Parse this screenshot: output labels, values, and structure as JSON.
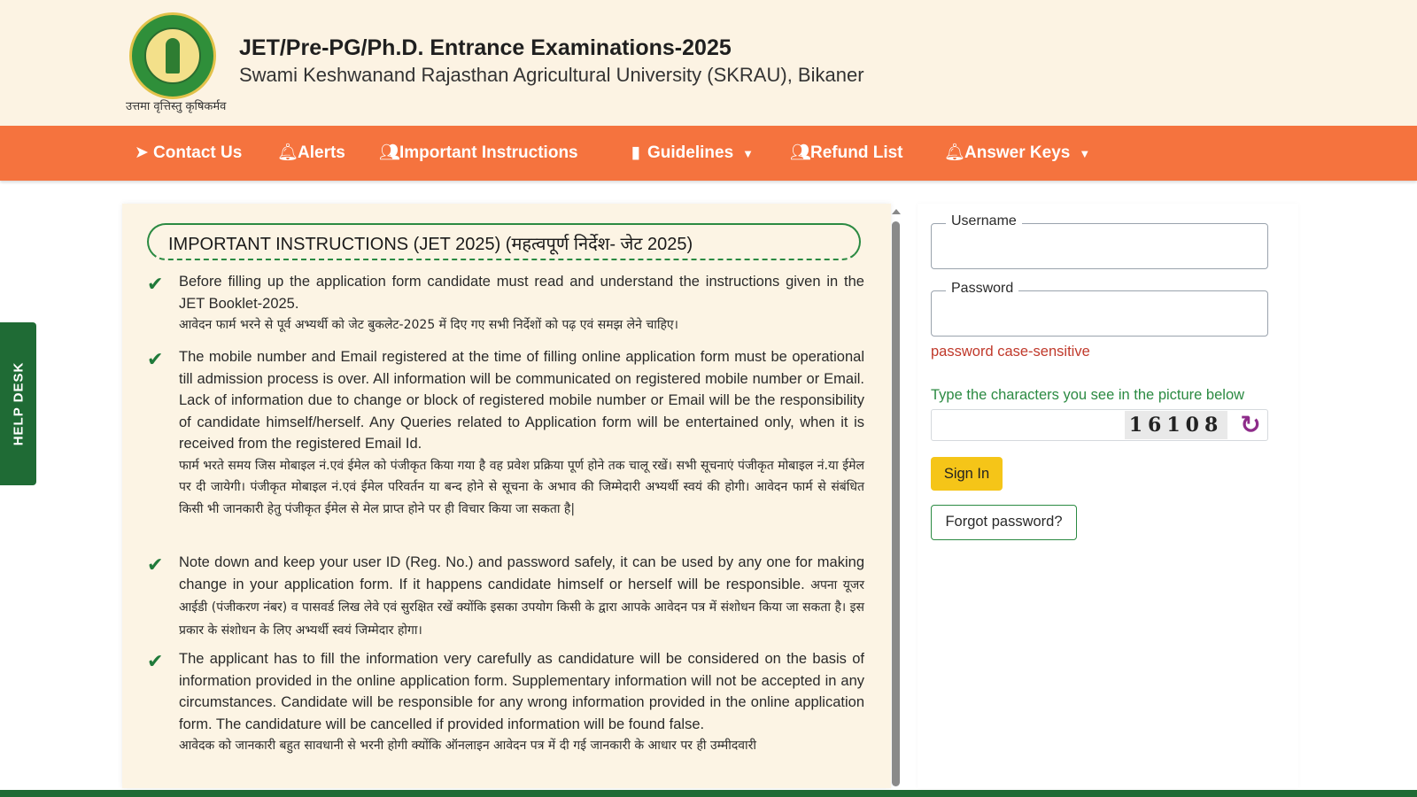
{
  "header": {
    "title": "JET/Pre-PG/Ph.D. Entrance Examinations-2025",
    "subtitle": "Swami Keshwanand Rajasthan Agricultural University (SKRAU), Bikaner",
    "motto": "उत्तमा वृत्तिस्तु कृषिकर्मव"
  },
  "nav": {
    "items": [
      {
        "label": "Contact Us",
        "icon": "paper-plane-icon"
      },
      {
        "label": "Alerts",
        "icon": "bell-icon"
      },
      {
        "label": "Important Instructions",
        "icon": "user-group-icon"
      },
      {
        "label": "Guidelines",
        "icon": "bar-chart-icon",
        "dropdown": true
      },
      {
        "label": "Refund List",
        "icon": "user-group-icon"
      },
      {
        "label": "Answer Keys",
        "icon": "bell-icon",
        "dropdown": true
      }
    ]
  },
  "helpdesk": {
    "label": "HELP DESK"
  },
  "instructions": {
    "heading": "IMPORTANT INSTRUCTIONS (JET 2025) (महत्वपूर्ण निर्देश- जेट 2025)",
    "items": [
      {
        "en": "Before filling up the application form candidate must read and understand the instructions given in the JET Booklet-2025.",
        "hi": "आवेदन फार्म भरने से पूर्व अभ्यर्थी को जेट बुकलेट-2025 में दिए गए सभी निर्देशों को पढ़ एवं समझ लेने चाहिए।"
      },
      {
        "en": "The mobile number and Email registered at the time of filling online application form must be operational till admission process is over. All information will be communicated on registered mobile number or Email. Lack of information due to change or block of registered mobile number or Email will be the responsibility of candidate himself/herself. Any Queries related to Application form will be entertained only, when it is received from the registered Email Id.",
        "hi": "फार्म भरते समय जिस मोबाइल नं.एवं ईमेल को पंजीकृत किया गया है वह प्रवेश प्रक्रिया पूर्ण होने तक चालू रखें। सभी सूचनाएं पंजीकृत मोबाइल नं.या ईमेल पर दी जायेगी। पंजीकृत मोबाइल नं.एवं ईमेल परिवर्तन या बन्द होने से सूचना के अभाव की जिम्मेदारी अभ्यर्थी स्वयं की होगी। आवेदन फार्म से संबंधित किसी भी जानकारी हेतु पंजीकृत ईमेल से मेल प्राप्त होने पर ही विचार किया जा सकता है|"
      },
      {
        "en": "Note down and keep your user ID (Reg. No.) and password safely, it can be used by any one for making change in your application form. If it happens candidate himself or herself will be responsible.",
        "hi": "अपना यूजर आईडी (पंजीकरण नंबर) व पासवर्ड लिख लेवे एवं सुरक्षित रखें क्योंकि इसका उपयोग किसी के द्वारा आपके आवेदन पत्र में संशोधन किया जा सकता है। इस प्रकार के संशोधन के लिए अभ्यर्थी स्वयं जिम्मेदार होगा।"
      },
      {
        "en": "The applicant has to fill the information very carefully as candidature will be considered on the basis of information provided in the online application form. Supplementary information will not be accepted in any circumstances. Candidate will be responsible for any wrong information provided in the online application form. The candidature will be cancelled if provided information will be found false.",
        "hi": "आवेदक को जानकारी बहुत सावधानी से भरनी होगी क्योंकि ऑनलाइन आवेदन पत्र में दी गई जानकारी के आधार पर ही उम्मीदवारी"
      }
    ]
  },
  "login": {
    "username_label": "Username",
    "username_value": "",
    "password_label": "Password",
    "password_value": "",
    "password_note": "password case-sensitive",
    "captcha_label": "Type the characters you see in the picture below",
    "captcha_value": "",
    "captcha_text": "16108",
    "signin_label": "Sign In",
    "forgot_label": "Forgot password?"
  },
  "colors": {
    "nav": "#f5733e",
    "header_bg": "#fcf3e3",
    "accent_green": "#2b8a42",
    "signin": "#f5c518",
    "error": "#c0392b"
  }
}
